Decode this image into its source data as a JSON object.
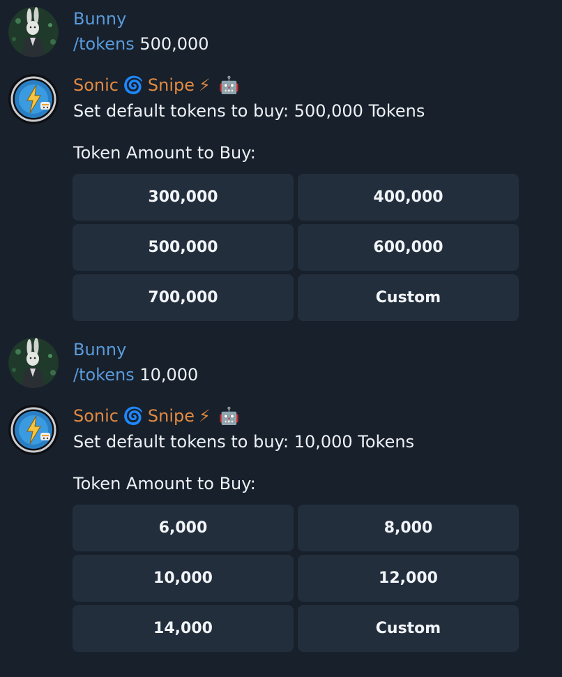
{
  "colors": {
    "background": "#17202b",
    "button": "#232e3d",
    "user_name": "#5b9bdb",
    "bot_name": "#e28a42",
    "command_link": "#5b9bdb",
    "text": "#eef1f5"
  },
  "messages": [
    {
      "sender": "Bunny",
      "avatar": "bunny-avatar",
      "command": "/tokens",
      "argument": " 500,000"
    },
    {
      "sender_parts": [
        "Sonic",
        "🌀",
        "Snipe",
        "⚡",
        "🤖"
      ],
      "avatar": "sonic-lightning-avatar",
      "text": "Set default tokens to buy: 500,000 Tokens",
      "prompt": "Token Amount to Buy:",
      "keyboard": [
        [
          "300,000",
          "400,000"
        ],
        [
          "500,000",
          "600,000"
        ],
        [
          "700,000",
          "Custom"
        ]
      ]
    },
    {
      "sender": "Bunny",
      "avatar": "bunny-avatar",
      "command": "/tokens",
      "argument": " 10,000"
    },
    {
      "sender_parts": [
        "Sonic",
        "🌀",
        "Snipe",
        "⚡",
        "🤖"
      ],
      "avatar": "sonic-lightning-avatar",
      "text": "Set default tokens to buy: 10,000 Tokens",
      "prompt": "Token Amount to Buy:",
      "keyboard": [
        [
          "6,000",
          "8,000"
        ],
        [
          "10,000",
          "12,000"
        ],
        [
          "14,000",
          "Custom"
        ]
      ]
    }
  ]
}
